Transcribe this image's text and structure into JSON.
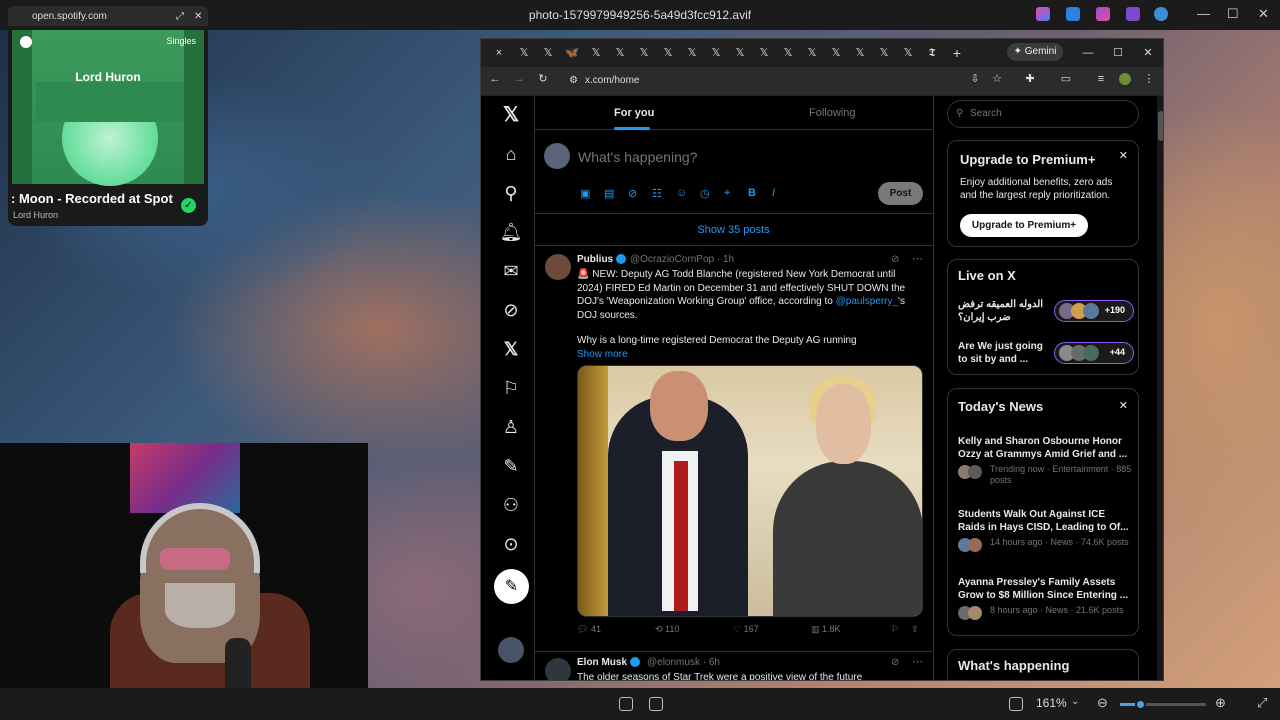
{
  "viewer": {
    "title": "photo-1579979949256-5a49d3fcc912.avif",
    "zoom": "161%"
  },
  "spotify": {
    "url": "open.spotify.com",
    "badge": "Singles",
    "art_artist": "Lord Huron",
    "track": ": Moon - Recorded at Spot",
    "artist": "Lord Huron",
    "check": "✓"
  },
  "browser": {
    "tab_close": "×",
    "new_tab": "+",
    "gemini_label": "✦ Gemini",
    "address": "x.com/home",
    "window_min": "—",
    "window_max": "☐",
    "window_close": "✕"
  },
  "x": {
    "tabs": [
      "For you",
      "Following"
    ],
    "compose_placeholder": "What's happening?",
    "post_button": "Post",
    "show_posts": "Show 35 posts",
    "tweet": {
      "name": "Publius",
      "handle": "@OcrazioCornPop · 1h",
      "body_1": "🚨 NEW: Deputy AG Todd Blanche (registered New York Democrat until 2024) FIRED Ed Martin on December 31 and effectively SHUT DOWN the DOJ's 'Weaponization Working Group' office, according to ",
      "body_link": "@paulsperry_",
      "body_2": "'s DOJ sources.",
      "body_3": "Why is a long-time registered Democrat the Deputy AG running",
      "show_more": "Show more",
      "replies": "41",
      "reposts": "110",
      "likes": "167",
      "views": "1.8K"
    },
    "tweet2": {
      "name": "Elon Musk",
      "handle": "@elonmusk · 6h",
      "body": "The older seasons of Star Trek were a positive view of the future"
    },
    "search_placeholder": "Search",
    "premium": {
      "title": "Upgrade to Premium+",
      "text": "Enjoy additional benefits, zero ads and the largest reply prioritization.",
      "button": "Upgrade to Premium+"
    },
    "live": {
      "title": "Live on X",
      "items": [
        {
          "title": "الدوله العميقه ترفض ضرب إيران؟",
          "count": "+190"
        },
        {
          "title": "Are We just going to sit by and ...",
          "count": "+44"
        }
      ]
    },
    "news": {
      "title": "Today's News",
      "items": [
        {
          "title": "Kelly and Sharon Osbourne Honor Ozzy at Grammys Amid Grief and ...",
          "meta": "Trending now · Entertainment · 885 posts"
        },
        {
          "title": "Students Walk Out Against ICE Raids in Hays CISD, Leading to Of...",
          "meta": "14 hours ago · News · 74.6K posts"
        },
        {
          "title": "Ayanna Pressley's Family Assets Grow to $8 Million Since Entering ...",
          "meta": "8 hours ago · News · 21.6K posts"
        }
      ]
    },
    "whats_happening": "What's happening"
  },
  "colors": {
    "accent": "#1d9bf0",
    "bg": "#000000",
    "spotify_green": "#1ed760"
  }
}
